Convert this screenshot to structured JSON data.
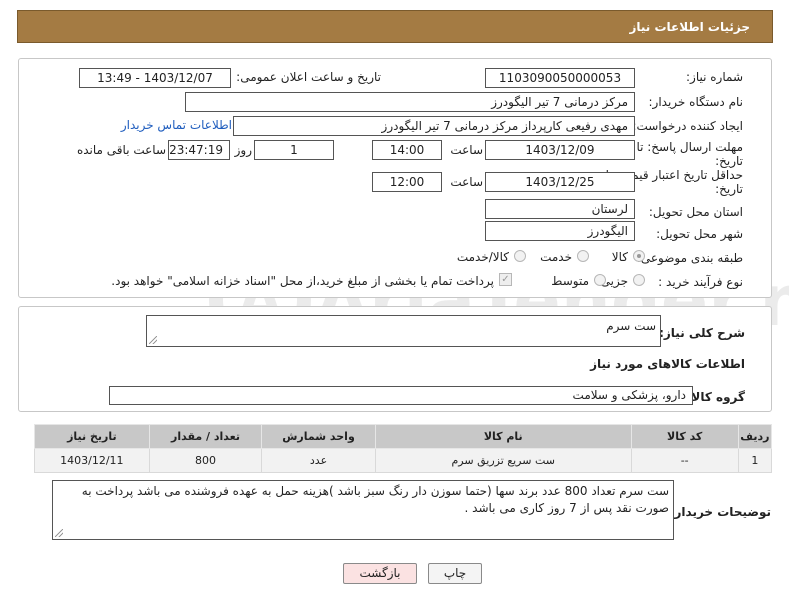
{
  "header": {
    "title": "جزئیات اطلاعات نیاز"
  },
  "form": {
    "need_number_label": "شماره نیاز:",
    "need_number": "1103090050000053",
    "announce_label": "تاریخ و ساعت اعلان عمومی:",
    "announce_value": "1403/12/07 - 13:49",
    "buyer_org_label": "نام دستگاه خریدار:",
    "buyer_org": "مرکز درمانی 7 تیر الیگودرز",
    "creator_label": "ایجاد کننده درخواست:",
    "creator": "مهدی رفیعی کارپرداز مرکز درمانی 7 تیر الیگودرز",
    "contact_link": "اطلاعات تماس خریدار",
    "reply_deadline_label_1": "مهلت ارسال پاسخ: تا",
    "reply_deadline_label_2": "تاریخ:",
    "reply_date": "1403/12/09",
    "time_label": "ساعت",
    "reply_time": "14:00",
    "days_value": "1",
    "days_label": "روز و",
    "remaining_time": "23:47:19",
    "remaining_label": "ساعت باقی مانده",
    "min_validity_label_1": "حداقل تاریخ اعتبار قیمت: تا",
    "min_validity_label_2": "تاریخ:",
    "validity_date": "1403/12/25",
    "validity_time": "12:00",
    "province_label": "استان محل تحویل:",
    "province": "لرستان",
    "city_label": "شهر محل تحویل:",
    "city": "الیگودرز",
    "category_label": "طبقه بندی موضوعی:",
    "category_options": [
      "کالا",
      "خدمت",
      "کالا/خدمت"
    ],
    "category_selected": "کالا",
    "purchase_type_label": "نوع فرآیند خرید :",
    "purchase_options": [
      "جزیی",
      "متوسط"
    ],
    "payment_note": "پرداخت تمام یا بخشی از مبلغ خرید،از محل \"اسناد خزانه اسلامی\" خواهد بود."
  },
  "description": {
    "label": "شرح کلی نیاز:",
    "value": "ست سرم"
  },
  "goods": {
    "section_title": "اطلاعات کالاهای مورد نیاز",
    "group_label": "گروه کالا:",
    "group_value": "دارو، پزشکی و سلامت",
    "columns": [
      "ردیف",
      "کد کالا",
      "نام کالا",
      "واحد شمارش",
      "تعداد / مقدار",
      "تاریخ نیاز"
    ],
    "rows": [
      {
        "row": "1",
        "code": "--",
        "name": "ست سریع تزریق سرم",
        "unit": "عدد",
        "qty": "800",
        "date": "1403/12/11"
      }
    ]
  },
  "buyer_notes": {
    "label": "توضیحات خریدار:",
    "text": "ست سرم تعداد 800 عدد برند سها (حتما سوزن دار رنگ سبز باشد )هزینه حمل به عهده فروشنده می باشد پرداخت به صورت نقد پس از 7 روز کاری می باشد ."
  },
  "buttons": {
    "print": "چاپ",
    "back": "بازگشت"
  },
  "watermark": {
    "text": "AriaTender.neT"
  },
  "colors": {
    "header_bg": "#a47b43",
    "back_button_bg": "#fbe2e2",
    "link": "#1f5dbe"
  }
}
